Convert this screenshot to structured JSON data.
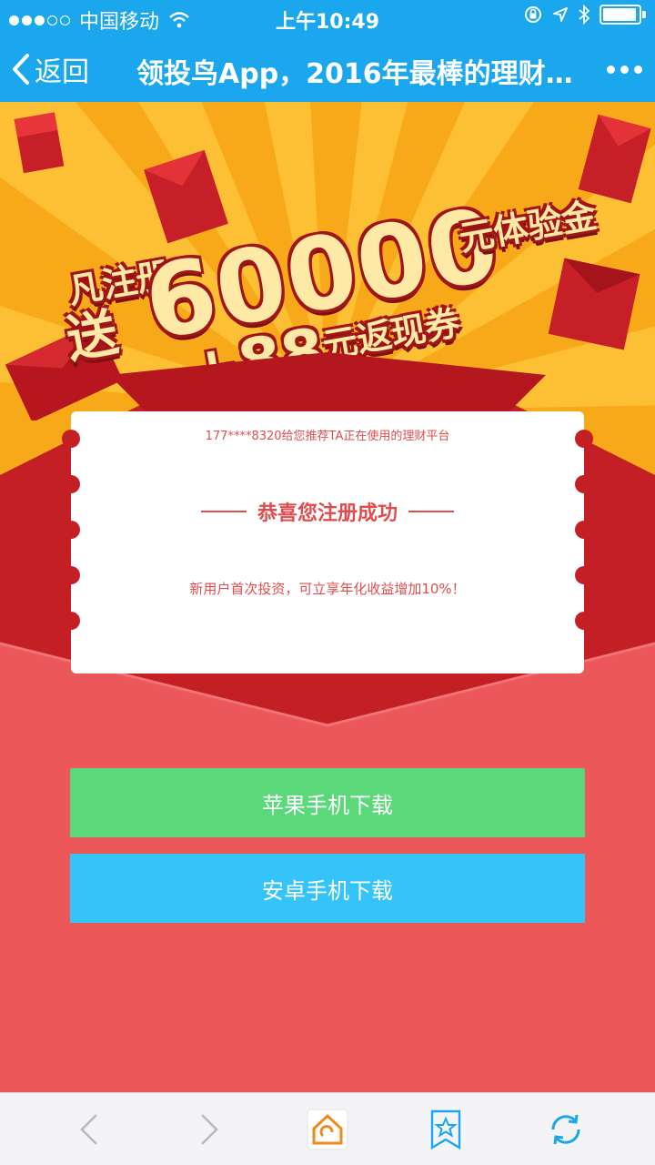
{
  "status_bar": {
    "carrier": "中国移动",
    "time": "上午10:49"
  },
  "nav": {
    "back_label": "返回",
    "title": "领投鸟App，2016年最棒的理财…"
  },
  "promo": {
    "line1": "凡注册",
    "line2": "送",
    "amount": "60000",
    "amount_unit": "元体验金",
    "bonus": "+88",
    "bonus_unit": "元返现券"
  },
  "card": {
    "referral_text": "177****8320给您推荐TA正在使用的理财平台",
    "congrats_text": "恭喜您注册成功",
    "offer_text": "新用户首次投资，可立享年化收益增加10%！"
  },
  "buttons": {
    "ios_label": "苹果手机下载",
    "android_label": "安卓手机下载"
  },
  "colors": {
    "nav_blue": "#1aa7ee",
    "ios_green": "#5bd87a",
    "android_blue": "#35c4fa",
    "envelope_red": "#ec5759",
    "text_red": "#e14d4d"
  }
}
